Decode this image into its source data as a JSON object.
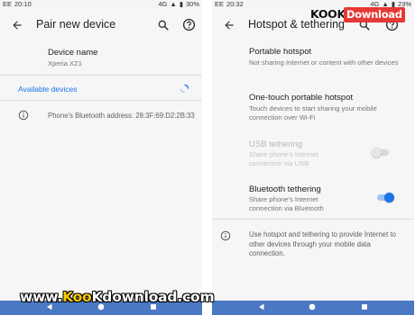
{
  "colors": {
    "accent": "#1a73e8",
    "toggle_on": "#1a73e8",
    "navbar": "#4a78c2",
    "logo_red": "#e53935",
    "watermark_yellow": "#ffcc00"
  },
  "left": {
    "status": {
      "carrier": "EE",
      "time": "20:10",
      "network": "4G",
      "battery": "30%"
    },
    "appbar": {
      "title": "Pair new device",
      "back_icon": "arrow-back-icon",
      "search_icon": "search-icon",
      "help_icon": "help-icon"
    },
    "device_name": {
      "title": "Device name",
      "value": "Xperia XZ1"
    },
    "available_devices": {
      "label": "Available devices",
      "progress_icon": "spinner-icon"
    },
    "bluetooth_info": "Phone's Bluetooth address: 28:3F:69:D2:2B:33"
  },
  "right": {
    "status": {
      "carrier": "EE",
      "time": "20:32",
      "network": "4G",
      "battery": "23%"
    },
    "appbar": {
      "title": "Hotspot & tethering",
      "back_icon": "arrow-back-icon",
      "search_icon": "search-icon",
      "help_icon": "help-icon"
    },
    "items": [
      {
        "title": "Portable hotspot",
        "subtitle": "Not sharing Internet or content with other devices"
      },
      {
        "title": "One-touch portable hotspot",
        "subtitle": "Touch devices to start sharing your mobile connection over Wi-Fi"
      },
      {
        "title": "USB tethering",
        "subtitle": "Share phone's Internet connection via USB",
        "enabled": false,
        "toggle_on": false
      },
      {
        "title": "Bluetooth tethering",
        "subtitle": "Share phone's Internet connection via Bluetooth",
        "enabled": true,
        "toggle_on": true
      }
    ],
    "info": "Use hotspot and tethering to provide Internet to other devices through your mobile data connection."
  },
  "logo": {
    "part1": "KOOK",
    "part2": "Download"
  },
  "watermark": {
    "prefix": "www.",
    "brand_yellow": "Koo",
    "brand_rest": "Kdownload.com"
  }
}
